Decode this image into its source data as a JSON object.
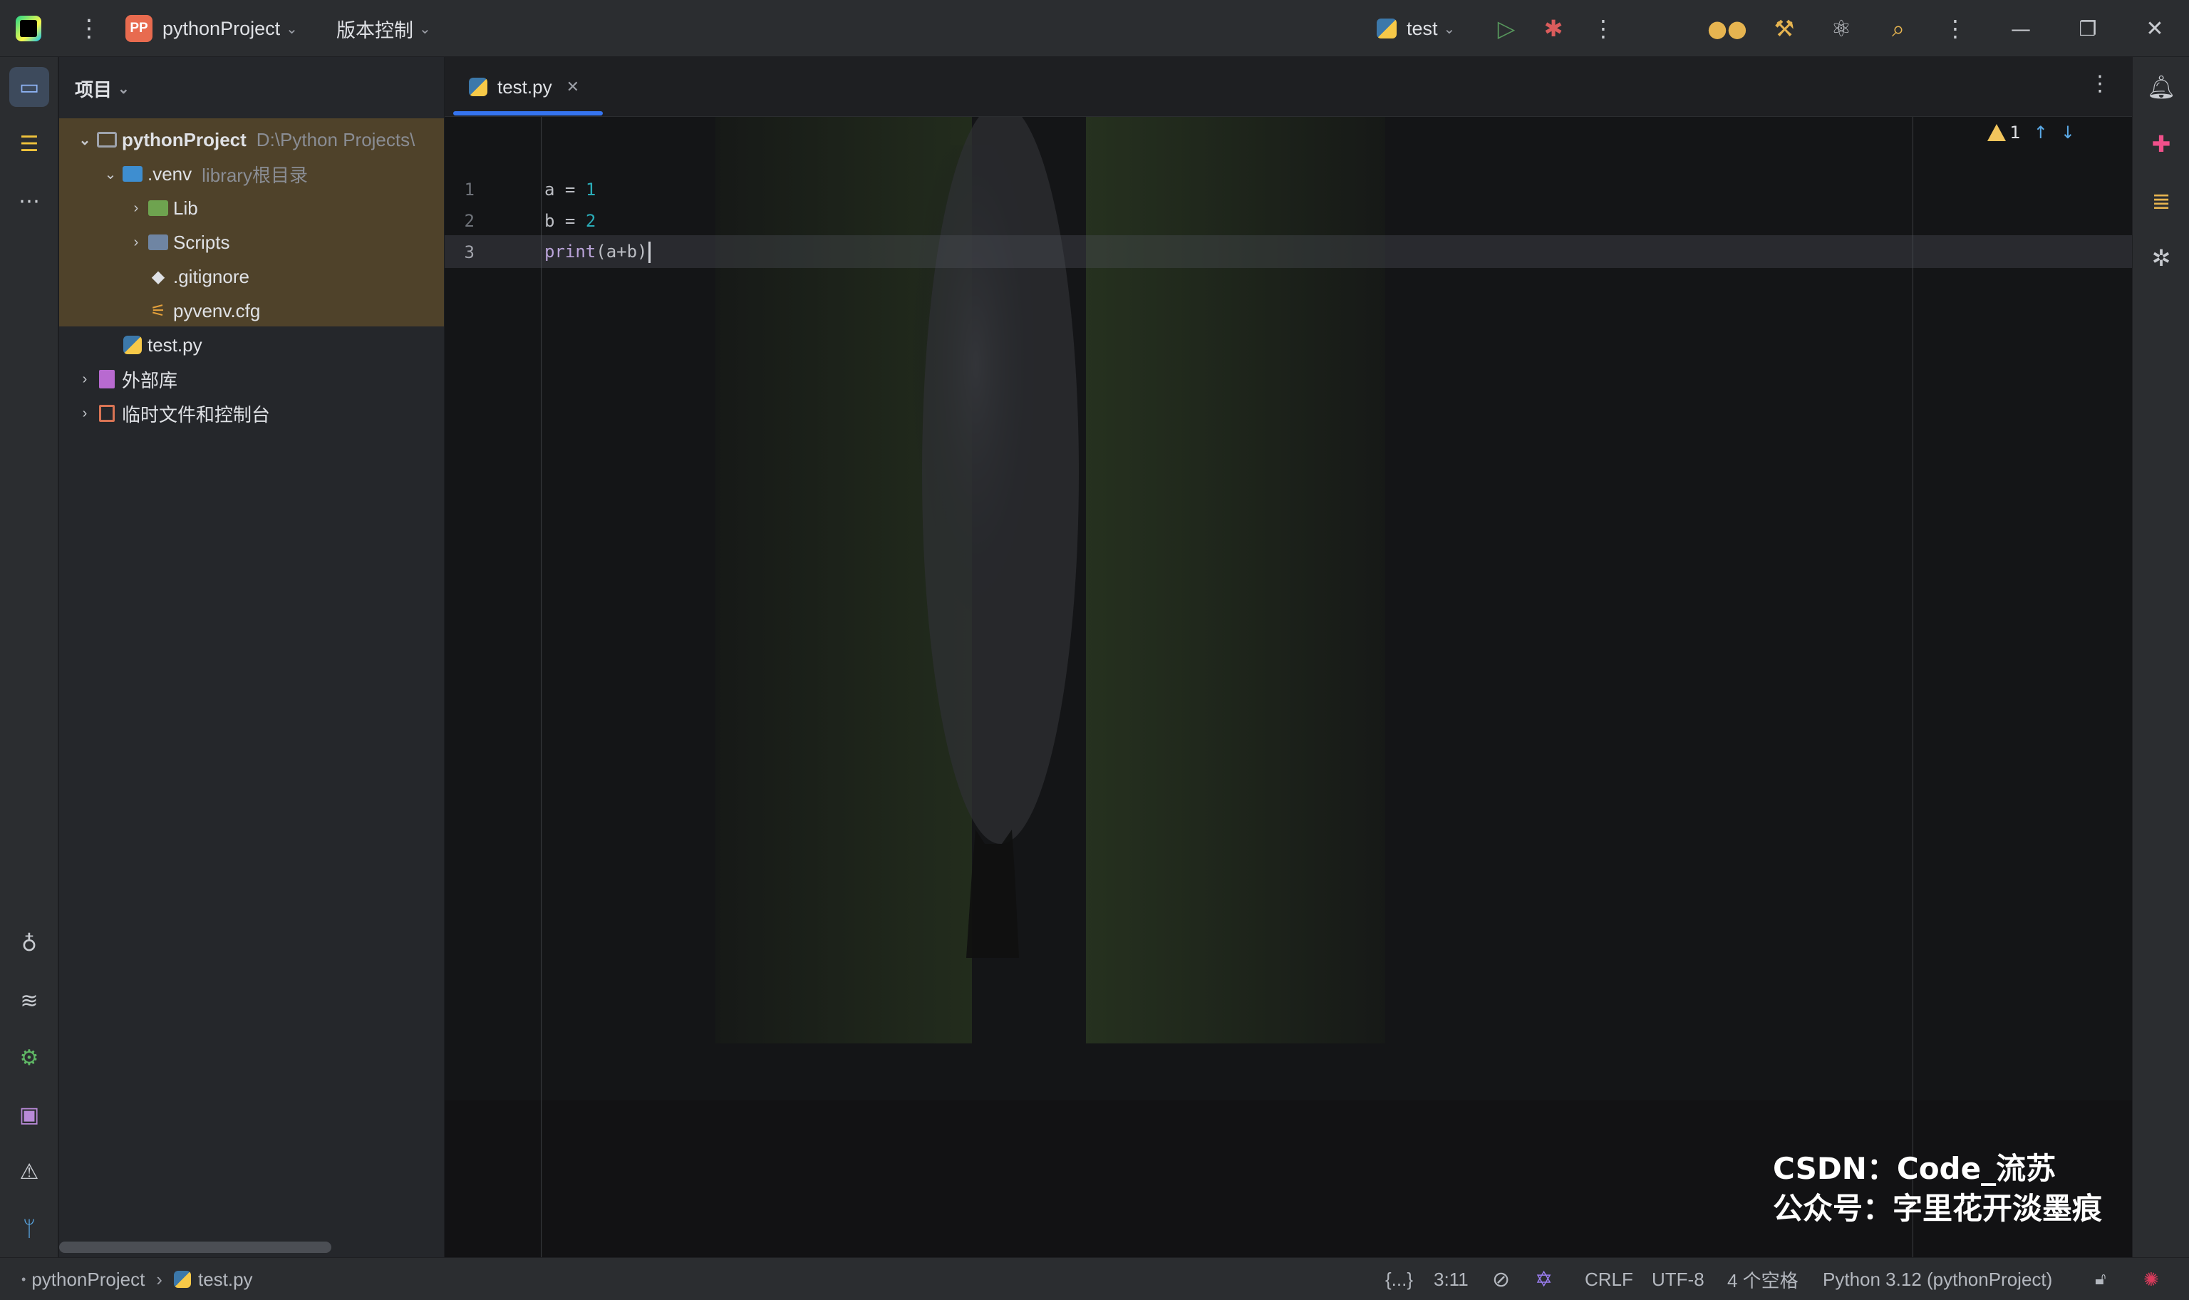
{
  "titlebar": {
    "project_badge": "PP",
    "project_name": "pythonProject",
    "vcs_menu": "版本控制",
    "run_config": "test"
  },
  "project_panel": {
    "title": "项目",
    "tree": [
      {
        "label": "pythonProject",
        "hint": "D:\\Python Projects\\"
      },
      {
        "label": ".venv",
        "hint": "library根目录"
      },
      {
        "label": "Lib",
        "hint": ""
      },
      {
        "label": "Scripts",
        "hint": ""
      },
      {
        "label": ".gitignore",
        "hint": ""
      },
      {
        "label": "pyvenv.cfg",
        "hint": ""
      },
      {
        "label": "test.py",
        "hint": ""
      },
      {
        "label": "外部库",
        "hint": ""
      },
      {
        "label": "临时文件和控制台",
        "hint": ""
      }
    ]
  },
  "editor": {
    "tab_label": "test.py",
    "line_numbers": [
      "1",
      "2",
      "3"
    ],
    "code": [
      {
        "var": "a",
        "op": " = ",
        "val": "1"
      },
      {
        "var": "b",
        "op": " = ",
        "val": "2"
      },
      {
        "fn": "print",
        "args": "(a+b)"
      }
    ],
    "warning_count": "1",
    "watermark_line1": "CSDN：Code_流苏",
    "watermark_line2": "公众号：字里花开淡墨痕"
  },
  "statusbar": {
    "breadcrumb_project": "pythonProject",
    "breadcrumb_file": "test.py",
    "braces": "{...}",
    "position": "3:11",
    "line_sep": "CRLF",
    "encoding": "UTF-8",
    "indent": "4 个空格",
    "interpreter": "Python 3.12 (pythonProject)"
  },
  "colors": {
    "accent": "#3574f0",
    "venv_highlight": "#5b4a2a",
    "number": "#2aacb8",
    "warning": "#f2c55c"
  }
}
